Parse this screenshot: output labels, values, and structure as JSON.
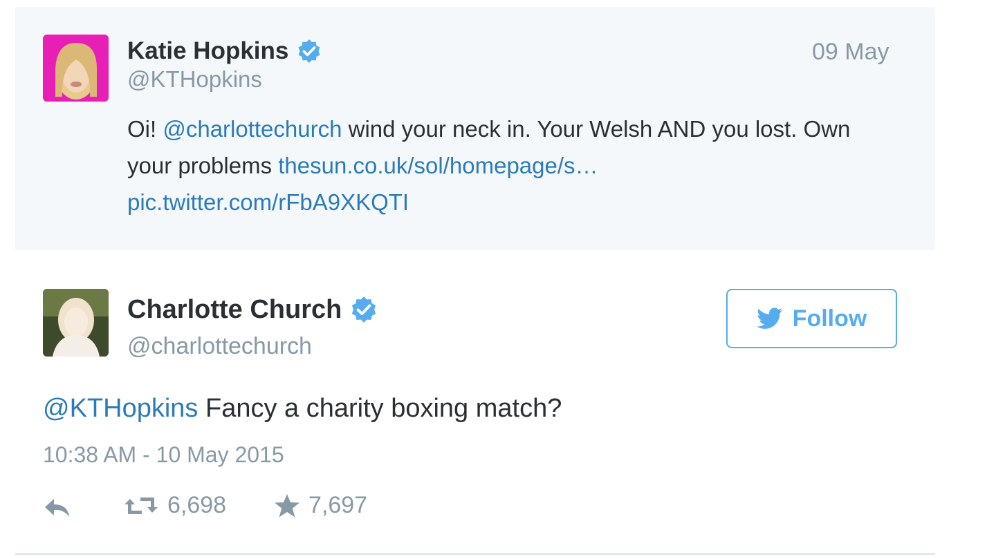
{
  "quoted_tweet": {
    "author_name": "Katie Hopkins",
    "handle": "@KTHopkins",
    "date": "09 May",
    "text_parts": {
      "prefix": "Oi! ",
      "mention": "@charlottechurch",
      "mid": " wind your neck in. Your Welsh AND you lost. Own your problems ",
      "link": "thesun.co.uk/sol/homepage/s…",
      "pic": "pic.twitter.com/rFbA9XKQTI"
    },
    "avatar_icon": "avatar-photo",
    "verified_icon": "verified-badge-icon"
  },
  "tweet": {
    "author_name": "Charlotte Church",
    "handle": "@charlottechurch",
    "follow_label": "Follow",
    "text_mention": "@KTHopkins",
    "text_body": " Fancy a charity boxing match?",
    "timestamp": "10:38 AM - 10 May 2015",
    "retweet_count": "6,698",
    "favorite_count": "7,697",
    "icons": [
      "reply-icon",
      "retweet-icon",
      "star-icon",
      "twitter-bird-icon",
      "verified-badge-icon"
    ]
  },
  "colors": {
    "link": "#2b7bb9",
    "accent": "#55acee",
    "muted": "#8899a6",
    "quoted_bg": "#f5f8fa"
  }
}
